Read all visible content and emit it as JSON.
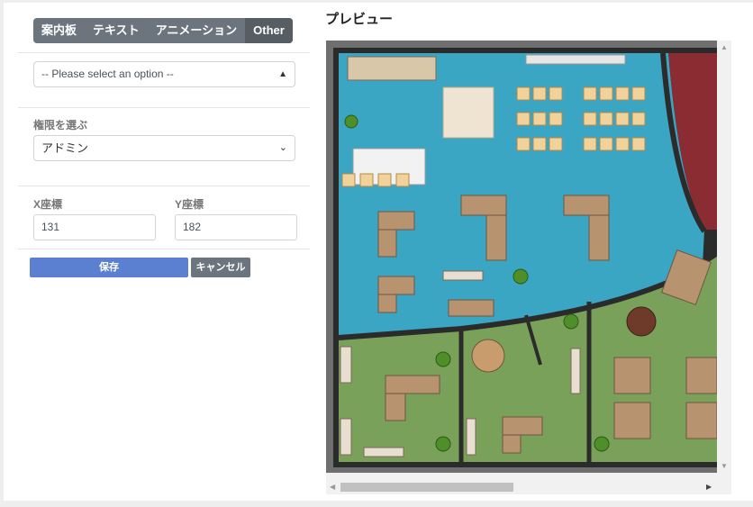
{
  "tabs": [
    "案内板",
    "テキスト",
    "アニメーション",
    "Other"
  ],
  "option_select": {
    "value": "-- Please select an option --"
  },
  "permission": {
    "label": "権限を選ぶ",
    "value": "アドミン"
  },
  "x_coord": {
    "label": "X座標",
    "value": "131"
  },
  "y_coord": {
    "label": "Y座標",
    "value": "182"
  },
  "buttons": {
    "save": "保存",
    "cancel": "キャンセル"
  },
  "preview": {
    "title": "プレビュー"
  },
  "colors": {
    "save": "#5b7fd1",
    "cancel": "#6c757d",
    "water": "#3aa6c3",
    "grass": "#7aa15a",
    "carpet": "#8b2c32",
    "floor": "#cfc7b8"
  }
}
